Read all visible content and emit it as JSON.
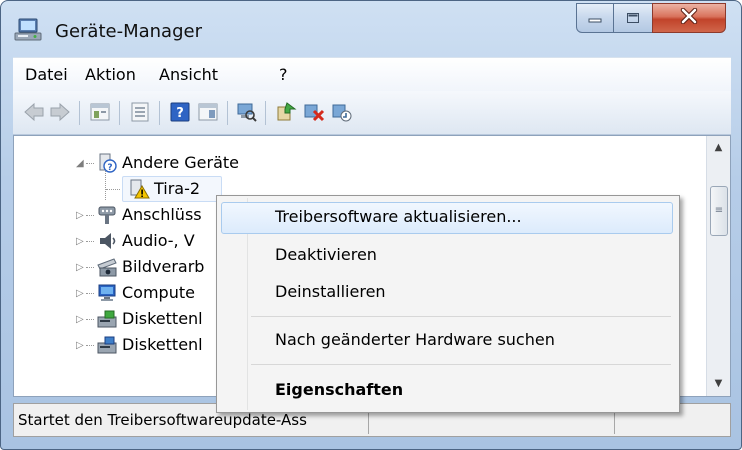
{
  "window": {
    "title": "Geräte-Manager",
    "title_icon": "device-manager-icon"
  },
  "caption_buttons": {
    "minimize_icon": "minimize-icon",
    "maximize_icon": "maximize-icon",
    "close_icon": "close-icon"
  },
  "menubar": {
    "items": [
      {
        "label": "Datei"
      },
      {
        "label": "Aktion"
      },
      {
        "label": "Ansicht"
      },
      {
        "label": "?"
      }
    ]
  },
  "toolbar": {
    "icons": [
      "back-arrow-icon",
      "forward-arrow-icon",
      "properties-window-icon",
      "console-tree-icon",
      "help-icon",
      "action-pane-icon",
      "scan-hardware-icon",
      "update-driver-icon",
      "uninstall-icon",
      "disable-device-icon"
    ]
  },
  "tree": {
    "items": [
      {
        "label": "Andere Geräte",
        "icon": "unknown-device-icon",
        "expanded": true
      },
      {
        "label": "Tira-2",
        "icon": "warning-device-icon",
        "selected": true
      },
      {
        "label": "Anschlüss",
        "icon": "ports-icon"
      },
      {
        "label": "Audio-, V",
        "icon": "audio-icon"
      },
      {
        "label": "Bildverarb",
        "icon": "imaging-device-icon"
      },
      {
        "label": "Compute",
        "icon": "computer-icon"
      },
      {
        "label": "Diskettenl",
        "icon": "floppy-drive-icon"
      },
      {
        "label": "Diskettenl",
        "icon": "floppy-controller-icon"
      }
    ]
  },
  "context_menu": {
    "items": [
      {
        "label": "Treibersoftware aktualisieren...",
        "highlighted": true
      },
      {
        "label": "Deaktivieren"
      },
      {
        "label": "Deinstallieren"
      },
      {
        "label": "Nach geänderter Hardware suchen"
      },
      {
        "label": "Eigenschaften",
        "bold": true
      }
    ]
  },
  "statusbar": {
    "text": "Startet den Treibersoftwareupdate-Ass"
  },
  "colors": {
    "highlight_border": "#a9cbee",
    "close_button": "#c1432a",
    "frame": "#b6cde8"
  }
}
